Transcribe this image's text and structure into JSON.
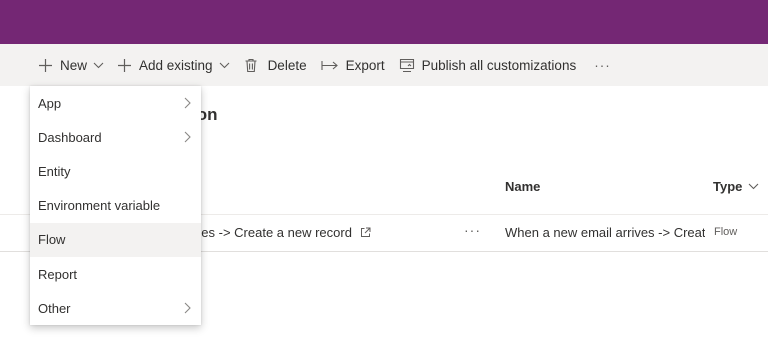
{
  "toolbar": {
    "new_label": "New",
    "add_existing_label": "Add existing",
    "delete_label": "Delete",
    "export_label": "Export",
    "publish_label": "Publish all customizations",
    "more_label": "···"
  },
  "page": {
    "title_visible": "ution"
  },
  "table": {
    "columns": {
      "name": "Name",
      "type": "Type"
    },
    "rows": [
      {
        "display_name": "arrives -> Create a new record",
        "more": "···",
        "name": "When a new email arrives -> Create a new record",
        "type": "Flow"
      }
    ]
  },
  "new_menu": {
    "items": [
      {
        "label": "App",
        "submenu": true
      },
      {
        "label": "Dashboard",
        "submenu": true
      },
      {
        "label": "Entity",
        "submenu": false
      },
      {
        "label": "Environment variable",
        "submenu": false
      },
      {
        "label": "Flow",
        "submenu": false,
        "hovered": true
      },
      {
        "label": "Report",
        "submenu": false
      },
      {
        "label": "Other",
        "submenu": true
      }
    ]
  },
  "colors": {
    "header": "#742774",
    "command_bar": "#f3f2f1",
    "hover": "#f3f2f1"
  }
}
